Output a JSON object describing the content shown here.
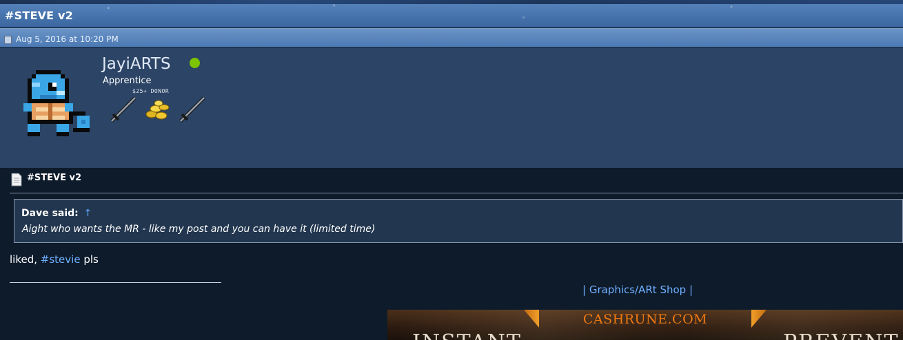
{
  "thread": {
    "title": "#STEVE v2"
  },
  "post_meta": {
    "date": "Aug 5, 2016 at 10:20 PM"
  },
  "user": {
    "username": "JayiARTS",
    "rank": "Apprentice",
    "donor_label": "$25+ DONOR",
    "online": true,
    "status_color": "#7cc400"
  },
  "post": {
    "title": "#STEVE v2",
    "quote": {
      "author": "Dave said:",
      "arrow": "↑",
      "text": "Aight who wants the MR - like my post and you can have it (limited time)"
    },
    "reply_prefix": "liked, ",
    "hashtag": "#stevie",
    "reply_suffix": " pls"
  },
  "signature": {
    "link_text": "| Graphics/ARt Shop |",
    "banner": {
      "brand": "CASHRUNE.COM",
      "left_word": "INSTANT",
      "right_word": "PREVENT"
    }
  },
  "colors": {
    "title_bar": "#4b78b2",
    "user_area": "#2c4465",
    "post_bg": "#0e1b2b",
    "link": "#6fb0ff",
    "banner_accent": "#f07a12"
  }
}
